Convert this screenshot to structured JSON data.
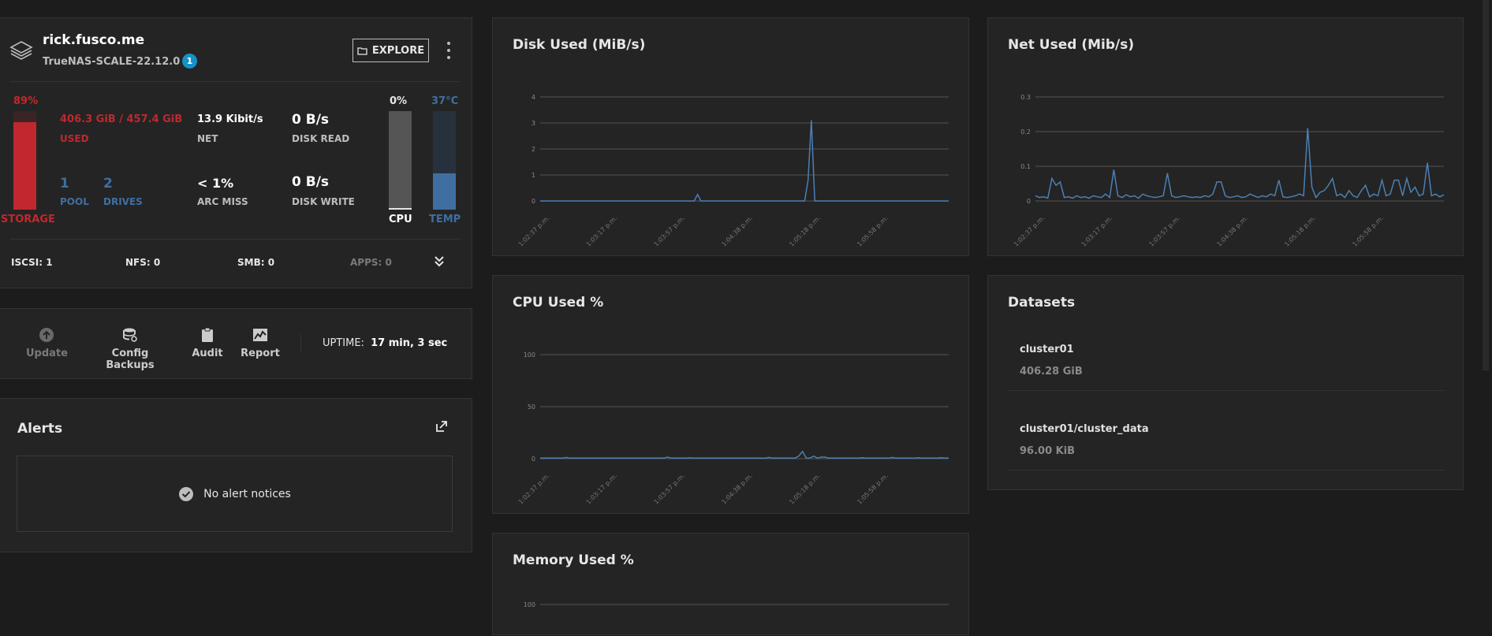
{
  "system": {
    "hostname": "rick.fusco.me",
    "version": "TrueNAS-SCALE-22.12.0",
    "badge_count": "1",
    "explore_label": "EXPLORE",
    "storage": {
      "percent_label": "89%",
      "percent": 89,
      "caption": "STORAGE",
      "used_value": "406.3 GiB / 457.4 GiB",
      "used_label": "USED",
      "pool_value": "1",
      "pool_label": "POOL",
      "drives_value": "2",
      "drives_label": "DRIVES"
    },
    "net": {
      "value": "13.9 Kibit/s",
      "label": "NET"
    },
    "disk_read": {
      "value": "0 B/s",
      "label": "DISK READ"
    },
    "arc_miss": {
      "value": "< 1%",
      "label": "ARC MISS"
    },
    "disk_write": {
      "value": "0 B/s",
      "label": "DISK WRITE"
    },
    "cpu": {
      "percent_label": "0%",
      "percent": 0,
      "caption": "CPU"
    },
    "temp": {
      "value_label": "37°C",
      "fill_fraction": 0.37,
      "caption": "TEMP"
    },
    "services": [
      {
        "label": "ISCSI: 1"
      },
      {
        "label": "NFS: 0"
      },
      {
        "label": "SMB: 0"
      },
      {
        "label": "APPS: 0"
      }
    ]
  },
  "actions": {
    "update": "Update",
    "config_backups": "Config Backups",
    "audit": "Audit",
    "report": "Report",
    "uptime_label": "UPTIME:",
    "uptime_value": "17 min, 3 sec"
  },
  "alerts": {
    "title": "Alerts",
    "empty_text": "No alert notices"
  },
  "datasets": {
    "title": "Datasets",
    "items": [
      {
        "name": "cluster01",
        "size": "406.28 GiB"
      },
      {
        "name": "cluster01/cluster_data",
        "size": "96.00 KiB"
      }
    ]
  },
  "colors": {
    "accent_blue": "#3f6fa0",
    "danger_red": "#c0282e",
    "line": "#4d7fb3"
  },
  "chart_data": [
    {
      "type": "line",
      "title": "Disk Used (MiB/s)",
      "x_ticks": [
        "1:02:37 p.m.",
        "1:03:17 p.m.",
        "1:03:57 p.m.",
        "1:04:38 p.m.",
        "1:05:18 p.m.",
        "1:05:58 p.m."
      ],
      "yticks": [
        0,
        1,
        2,
        3,
        4
      ],
      "ylim": [
        0,
        4
      ],
      "grid": true,
      "series": [
        {
          "values": [
            0,
            0,
            0,
            0,
            0,
            0,
            0,
            0,
            0,
            0,
            0,
            0,
            0,
            0,
            0,
            0,
            0,
            0,
            0,
            0,
            0,
            0,
            0,
            0,
            0,
            0,
            0,
            0,
            0,
            0,
            0,
            0,
            0,
            0,
            0,
            0,
            0,
            0,
            0,
            0,
            0,
            0,
            0,
            0,
            0,
            0,
            0,
            0.25,
            0,
            0,
            0,
            0,
            0,
            0,
            0,
            0,
            0,
            0,
            0,
            0,
            0,
            0,
            0,
            0,
            0,
            0,
            0,
            0,
            0,
            0,
            0,
            0,
            0,
            0,
            0,
            0,
            0,
            0,
            0,
            0,
            0.8,
            3.1,
            0,
            0,
            0,
            0,
            0,
            0,
            0,
            0,
            0,
            0,
            0,
            0,
            0,
            0,
            0,
            0,
            0,
            0,
            0,
            0,
            0,
            0,
            0,
            0,
            0,
            0,
            0,
            0,
            0,
            0,
            0,
            0,
            0,
            0,
            0,
            0,
            0,
            0,
            0,
            0,
            0
          ]
        }
      ]
    },
    {
      "type": "line",
      "title": "Net Used (Mib/s)",
      "x_ticks": [
        "1:02:37 p.m.",
        "1:03:17 p.m.",
        "1:03:57 p.m.",
        "1:04:38 p.m.",
        "1:05:18 p.m.",
        "1:05:58 p.m."
      ],
      "yticks": [
        0,
        0.1,
        0.2,
        0.3
      ],
      "ylim": [
        0,
        0.3
      ],
      "grid": true,
      "series": [
        {
          "values": [
            0.015,
            0.01,
            0.012,
            0.008,
            0.065,
            0.045,
            0.055,
            0.01,
            0.012,
            0.008,
            0.015,
            0.01,
            0.012,
            0.008,
            0.015,
            0.012,
            0.01,
            0.02,
            0.01,
            0.09,
            0.015,
            0.01,
            0.018,
            0.012,
            0.015,
            0.008,
            0.02,
            0.015,
            0.012,
            0.01,
            0.012,
            0.015,
            0.08,
            0.015,
            0.01,
            0.012,
            0.015,
            0.012,
            0.01,
            0.012,
            0.01,
            0.015,
            0.012,
            0.02,
            0.055,
            0.055,
            0.015,
            0.01,
            0.012,
            0.015,
            0.01,
            0.012,
            0.02,
            0.015,
            0.01,
            0.015,
            0.012,
            0.02,
            0.015,
            0.06,
            0.012,
            0.01,
            0.012,
            0.015,
            0.02,
            0.015,
            0.21,
            0.04,
            0.01,
            0.025,
            0.03,
            0.045,
            0.065,
            0.015,
            0.02,
            0.01,
            0.03,
            0.015,
            0.01,
            0.03,
            0.045,
            0.012,
            0.02,
            0.015,
            0.06,
            0.015,
            0.02,
            0.06,
            0.06,
            0.015,
            0.065,
            0.025,
            0.04,
            0.015,
            0.02,
            0.11,
            0.015,
            0.02,
            0.012,
            0.018
          ]
        }
      ]
    },
    {
      "type": "line",
      "title": "CPU Used %",
      "x_ticks": [
        "1:02:37 p.m.",
        "1:03:17 p.m.",
        "1:03:57 p.m.",
        "1:04:38 p.m.",
        "1:05:18 p.m.",
        "1:05:58 p.m."
      ],
      "yticks": [
        0,
        50,
        100
      ],
      "ylim": [
        0,
        100
      ],
      "grid": true,
      "series": [
        {
          "values": [
            0.5,
            0.5,
            0.5,
            0.5,
            0.5,
            0.5,
            0.5,
            1.2,
            0.5,
            0.5,
            0.5,
            0.5,
            0.5,
            0.5,
            0.5,
            0.5,
            0.5,
            0.5,
            0.5,
            0.5,
            0.5,
            0.5,
            0.5,
            0.5,
            0.5,
            0.5,
            0.5,
            0.5,
            0.5,
            0.5,
            0.5,
            0.5,
            0.5,
            0.5,
            1.5,
            0.5,
            0.5,
            0.5,
            0.5,
            0.5,
            0.8,
            0.5,
            0.5,
            0.5,
            0.5,
            0.5,
            0.5,
            0.5,
            0.5,
            0.5,
            0.5,
            0.5,
            0.5,
            0.5,
            0.5,
            0.5,
            0.5,
            0.5,
            0.5,
            0.5,
            0.5,
            1.2,
            0.5,
            0.5,
            0.5,
            0.5,
            0.5,
            0.5,
            0.5,
            2.5,
            7,
            0.5,
            0.5,
            2.5,
            0.5,
            1.5,
            1.5,
            0.5,
            0.5,
            0.5,
            0.5,
            0.5,
            0.5,
            0.5,
            0.5,
            0.5,
            1,
            0.5,
            0.5,
            0.5,
            0.5,
            0.5,
            0.5,
            0.5,
            1.2,
            0.5,
            0.5,
            0.5,
            0.5,
            0.5,
            0.5,
            1,
            0.5,
            0.5,
            0.5,
            0.5,
            0.5,
            1,
            0.5,
            0.5
          ]
        }
      ]
    },
    {
      "type": "line",
      "title": "Memory Used %",
      "x_ticks": [],
      "yticks": [
        100
      ],
      "ylim": [
        0,
        100
      ],
      "grid": true,
      "series": []
    }
  ]
}
